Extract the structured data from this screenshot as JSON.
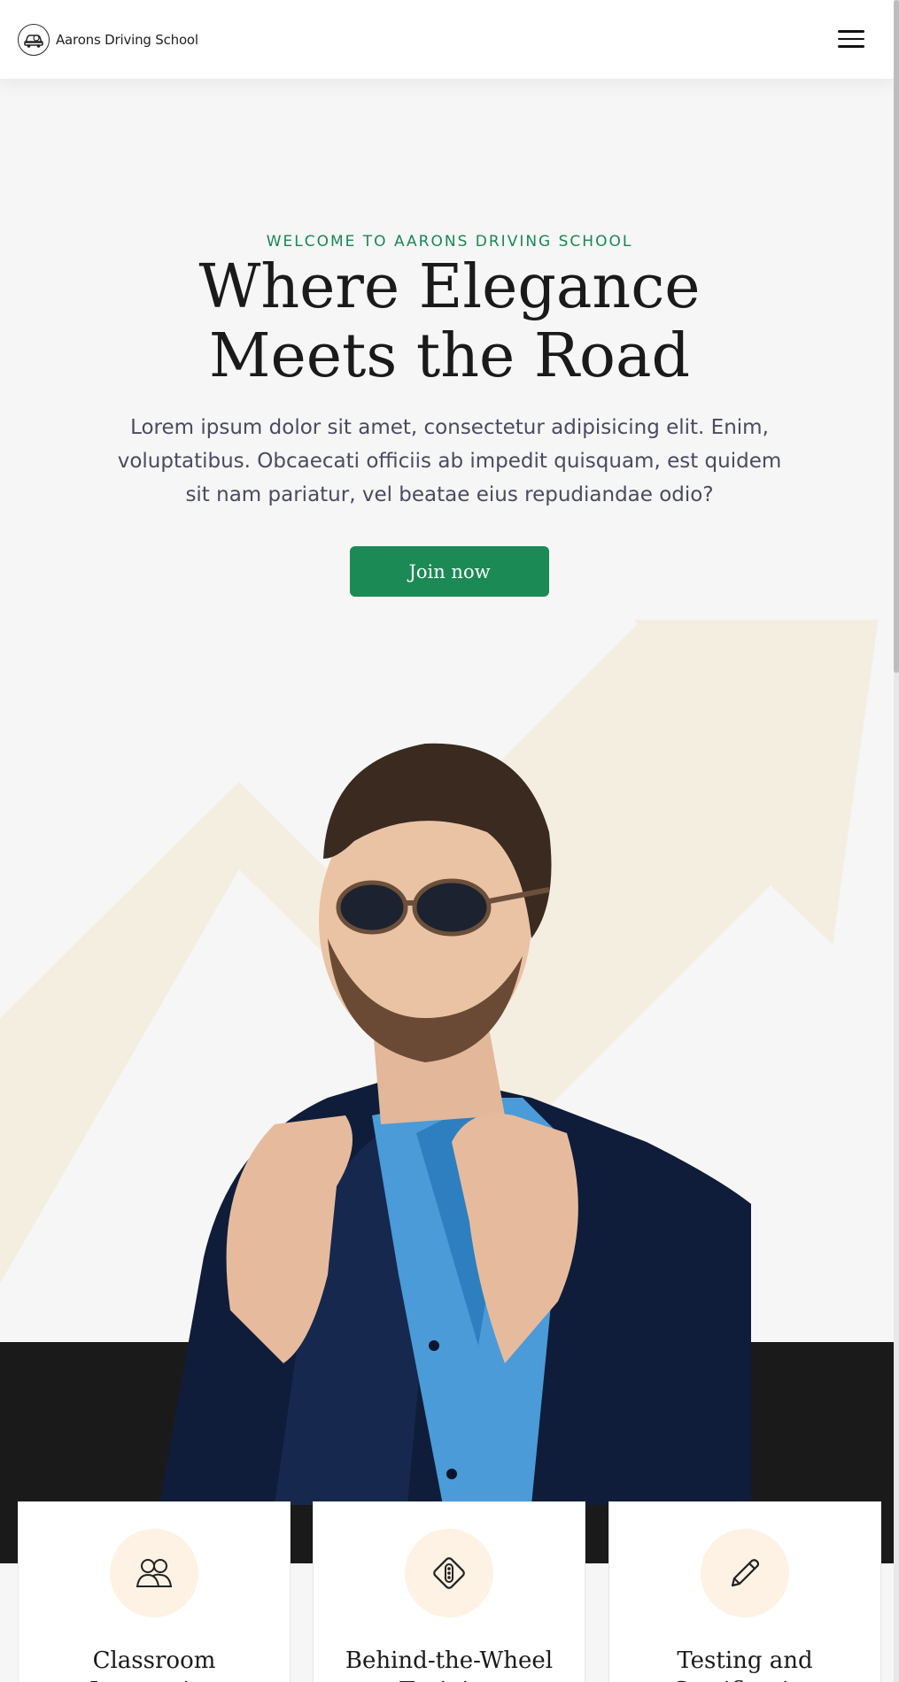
{
  "header": {
    "brand_name": "Aarons Driving School",
    "logo_icon": "steering-car-icon",
    "menu_icon": "hamburger-menu-icon"
  },
  "hero": {
    "eyebrow": "WELCOME TO AARONS DRIVING SCHOOL",
    "title_line1": "Where Elegance",
    "title_line2": "Meets the Road",
    "description": "Lorem ipsum dolor sit amet, consectetur adipisicing elit. Enim, voluptatibus. Obcaecati officiis ab impedit quisquam, est quidem sit nam pariatur, vel beatae eius repudiandae odio?",
    "cta_label": "Join now",
    "image_subject": "man in sunglasses and navy suit adjusting collar"
  },
  "features": [
    {
      "icon": "users-icon",
      "title": "Classroom Instruction"
    },
    {
      "icon": "road-sign-icon",
      "title": "Behind-the-Wheel Training"
    },
    {
      "icon": "pencil-icon",
      "title": "Testing and Certification"
    }
  ],
  "colors": {
    "accent": "#1b8a55",
    "eyebrow": "#198754",
    "arrow_bg": "#f4eee1",
    "dark_band": "#1a1a1a",
    "icon_circle": "#fdf2e3"
  }
}
